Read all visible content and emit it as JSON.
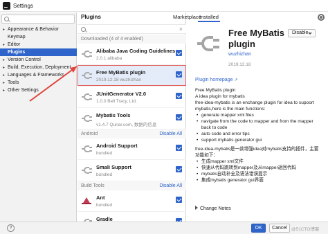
{
  "window": {
    "title": "Settings"
  },
  "tree": {
    "items": [
      {
        "label": "Appearance & Behavior",
        "expandable": true,
        "selected": false
      },
      {
        "label": "Keymap",
        "expandable": false,
        "selected": false
      },
      {
        "label": "Editor",
        "expandable": true,
        "selected": false
      },
      {
        "label": "Plugins",
        "expandable": false,
        "selected": true
      },
      {
        "label": "Version Control",
        "expandable": true,
        "selected": false
      },
      {
        "label": "Build, Execution, Deployment",
        "expandable": true,
        "selected": false
      },
      {
        "label": "Languages & Frameworks",
        "expandable": true,
        "selected": false
      },
      {
        "label": "Tools",
        "expandable": true,
        "selected": false
      },
      {
        "label": "Other Settings",
        "expandable": true,
        "selected": false
      }
    ]
  },
  "plugins_panel": {
    "title": "Plugins",
    "tabs": [
      "Marketplace",
      "Installed"
    ],
    "active_tab": "Installed",
    "sections": [
      {
        "label": "Downloaded (4 of 4 enabled)",
        "action": ""
      },
      {
        "label": "Android",
        "action": "Disable All"
      },
      {
        "label": "Build Tools",
        "action": "Disable All"
      }
    ],
    "downloaded": [
      {
        "name": "Alibaba Java Coding Guidelines",
        "meta": "2.0.1  alibaba",
        "icon": "plug-icon",
        "enabled": true
      },
      {
        "name": "Free MyBatis plugin",
        "meta": "2019.12.18  wuzhizhan",
        "icon": "plug-icon",
        "enabled": true
      },
      {
        "name": "JUnitGenerator V2.0",
        "meta": "1.0.0  Bell Tracy, Ltd.",
        "icon": "plug-icon",
        "enabled": true
      },
      {
        "name": "Mybatis Tools",
        "meta": "v1.4.7  Qunar.com, 数据的信息",
        "icon": "plug-icon",
        "enabled": true
      }
    ],
    "android": [
      {
        "name": "Android Support",
        "meta": "bundled",
        "icon": "plug-icon",
        "enabled": true
      },
      {
        "name": "Smali Support",
        "meta": "bundled",
        "icon": "plug-icon",
        "enabled": true
      }
    ],
    "build_tools": [
      {
        "name": "Ant",
        "meta": "bundled",
        "icon": "ant-icon",
        "enabled": true
      },
      {
        "name": "Gradle",
        "meta": "",
        "icon": "gradle-icon",
        "enabled": true
      }
    ]
  },
  "detail": {
    "title": "Free MyBatis plugin",
    "vendor": "wuzhizhan",
    "date": "2019.12.18",
    "disable_button": "Disable",
    "homepage_label": "Plugin homepage",
    "description_lines": [
      "Free MyBatis plugin",
      "A idea plugin for mybatis",
      "free-idea-mybatis is an enchange plugin for idea to supoort mybatis,here is the main functions:"
    ],
    "features_en": [
      "generate mapper xml files",
      "navigate from the code to mapper and from the mapper back to code",
      "auto code and error tips",
      "support mybatis generator gui"
    ],
    "description_cn": "free-idea-mybatis是一款增强idea对mybatis支持的插件，主要功能如下：",
    "features_cn": [
      "生成mapper xml文件",
      "快速从代码跳转到mapper及从mapper返回代码",
      "mybatis自动补全及语法错误提示",
      "集成mybatis generator gui界面"
    ],
    "change_notes_label": "Change Notes"
  },
  "footer": {
    "help_symbol": "?",
    "ok_label": "OK",
    "cancel_label": "Cancel",
    "watermark": "@51CTO博客"
  },
  "colors": {
    "accent": "#2f65ca",
    "highlight_border": "#e36159",
    "arrow": "#e0453c"
  }
}
